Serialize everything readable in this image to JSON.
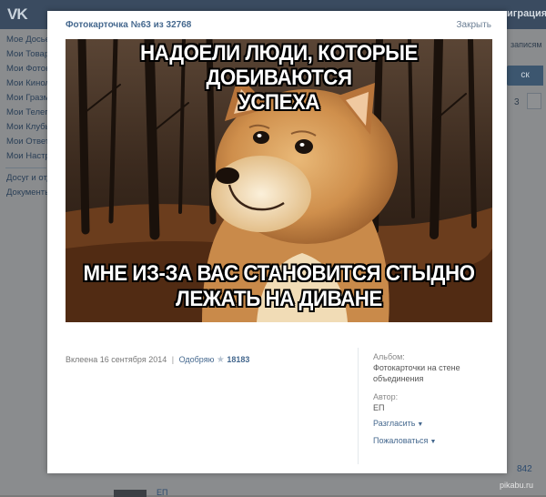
{
  "vk": {
    "logo": "VK",
    "top_right": "играция",
    "menu": [
      "Мое Досье",
      "Мои Товари",
      "Мои Фотока",
      "Мои Киноле",
      "Мои Гразма",
      "Мои Телегр",
      "Мои Клубы",
      "Мои Ответы",
      "Мои Настро"
    ],
    "menu_extra": [
      "Досуг и отд",
      "Документы"
    ],
    "right_text": "записям",
    "right_button": "ск",
    "right_number": "3",
    "bottom_count": "842",
    "bottom_name": "ЕП"
  },
  "modal": {
    "title": "Фотокарточка №63 из 32768",
    "close": "Закрыть"
  },
  "meme": {
    "top_lines": [
      "НАДОЕЛИ ЛЮДИ, КОТОРЫЕ ДОБИВАЮТСЯ",
      "УСПЕХА"
    ],
    "bottom_lines": [
      "МНЕ ИЗ-ЗА ВАС СТАНОВИТСЯ СТЫДНО",
      "ЛЕЖАТЬ НА ДИВАНЕ"
    ]
  },
  "info": {
    "pasted": "Вклеена 16 сентября 2014",
    "approve": "Одобряю",
    "likes": "18183"
  },
  "side": {
    "album_label": "Альбом:",
    "album_value_1": "Фотокарточки на стене",
    "album_value_2": "объединения",
    "author_label": "Автор:",
    "author_value": "ЕП",
    "share": "Разгласить",
    "report": "Пожаловаться"
  },
  "watermark": "pikabu.ru"
}
